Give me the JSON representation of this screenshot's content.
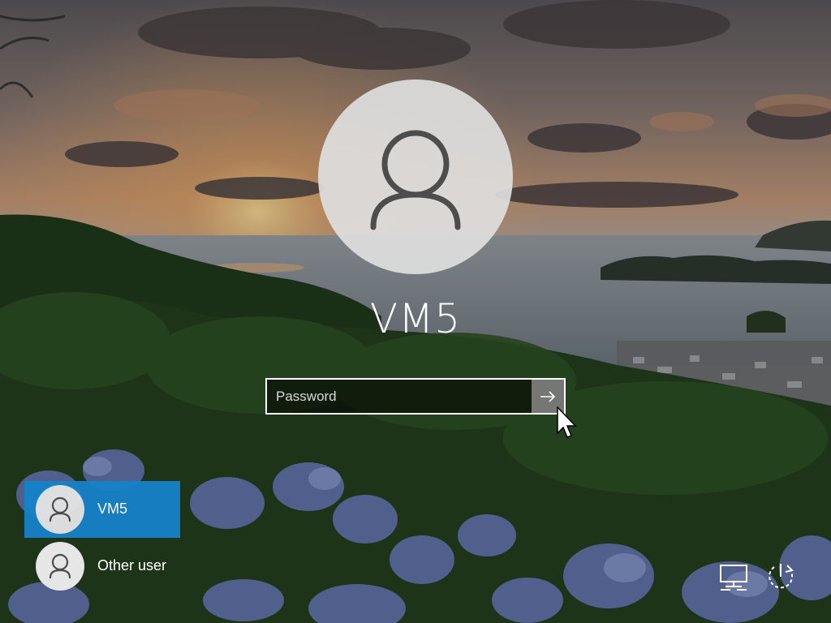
{
  "user": {
    "name": "VM5"
  },
  "password": {
    "placeholder": "Password",
    "value": ""
  },
  "user_list": [
    {
      "name": "VM5",
      "selected": true
    },
    {
      "name": "Other user",
      "selected": false
    }
  ],
  "icons": {
    "avatar": "person-silhouette-icon",
    "submit": "right-arrow-icon",
    "network": "network-icon",
    "power": "power-restart-icon",
    "cursor": "mouse-pointer-icon"
  },
  "colors": {
    "selected_tile": "#1682c9",
    "avatar_bg": "#dedede",
    "avatar_fg": "#4d4d4d",
    "text": "#ffffff"
  }
}
